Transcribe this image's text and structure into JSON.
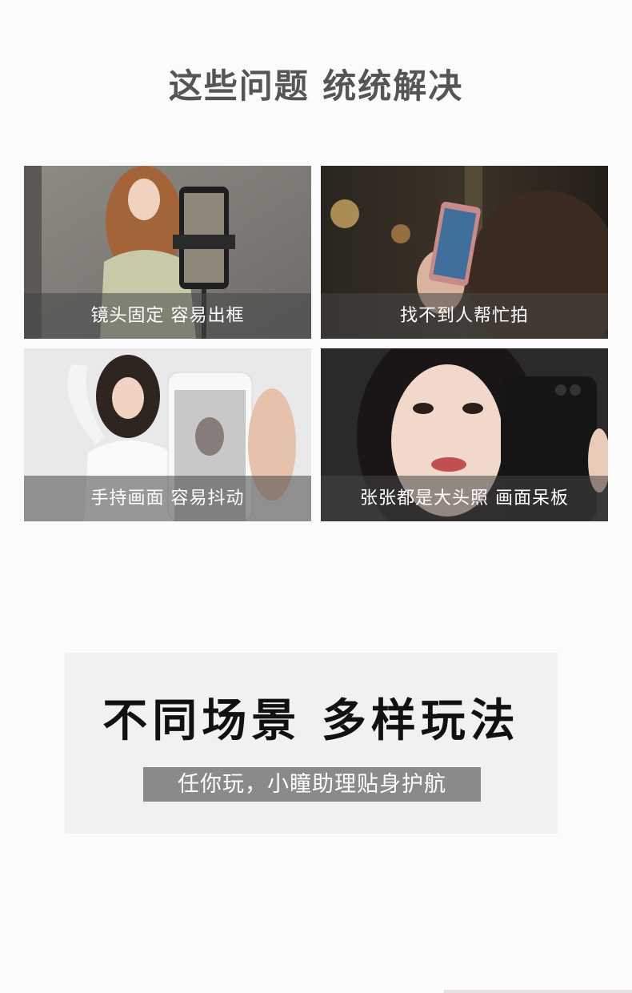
{
  "header": {
    "title": "这些问题 统统解决"
  },
  "tiles": [
    {
      "caption": "镜头固定 容易出框"
    },
    {
      "caption": "找不到人帮忙拍"
    },
    {
      "caption": "手持画面 容易抖动"
    },
    {
      "caption": "张张都是大头照 画面呆板"
    }
  ],
  "banner": {
    "title": "不同场景 多样玩法",
    "subtitle": "任你玩，小瞳助理贴身护航"
  },
  "colors": {
    "heading": "#555555",
    "caption_bar": "#464646",
    "banner_bg": "#f1f1f1",
    "subtitle_bg": "#8a8a8a"
  }
}
